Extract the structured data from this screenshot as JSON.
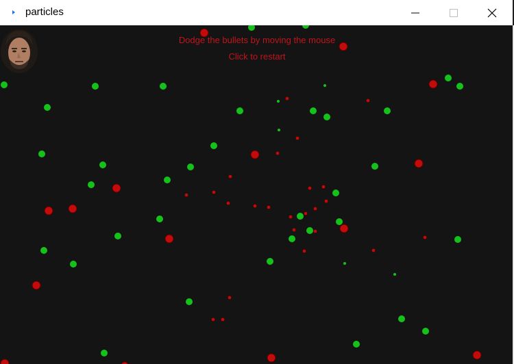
{
  "window": {
    "title": "particles"
  },
  "icons": {
    "app": "app-icon",
    "minimize": "minimize-icon",
    "maximize": "maximize-icon",
    "close": "close-icon"
  },
  "game": {
    "message_line1": "Dodge the bullets by  moving the mouse",
    "message_line2": "Click to restart",
    "message_color": "#c0151b",
    "background_color": "#141414",
    "bullet_color": "#c40b0b",
    "particle_color": "#15c21a"
  }
}
